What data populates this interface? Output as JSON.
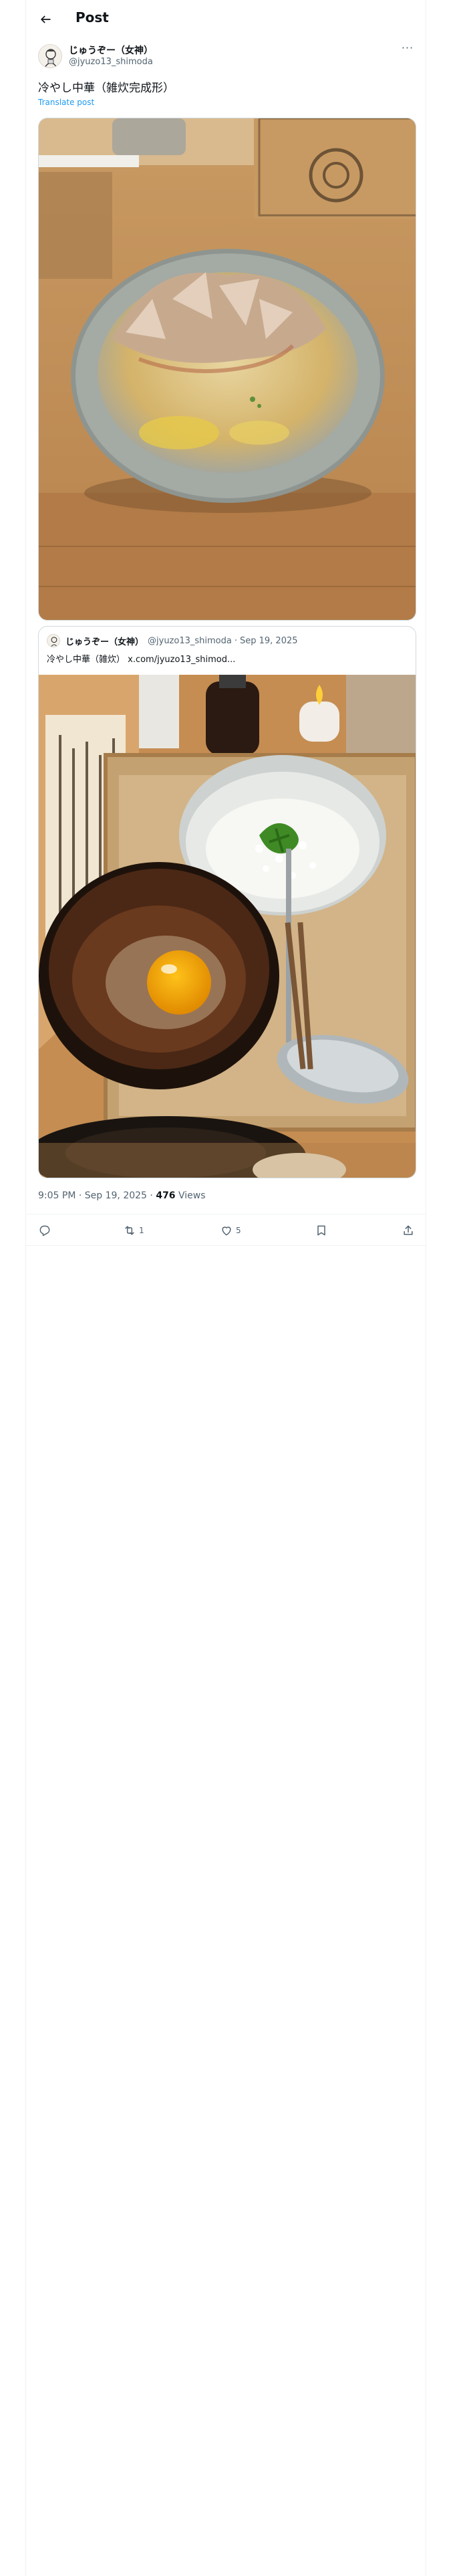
{
  "header": {
    "title": "Post",
    "back_icon": "arrow-left-icon"
  },
  "post": {
    "display_name": "じゅうぞー（女神）",
    "handle": "@jyuzo13_shimoda",
    "text": "冷やし中華（雑炊完成形）",
    "translate_label": "Translate post",
    "more_icon": "more-horizontal-icon",
    "time": "9:05 PM",
    "date": "Sep 19, 2025",
    "views_count": "476",
    "views_label": "Views",
    "sep": "·"
  },
  "quote": {
    "display_name": "じゅうぞー（女神）",
    "handle": "@jyuzo13_shimoda",
    "date": "Sep 19, 2025",
    "text": "冷やし中華（雑炊） x.com/jyuzo13_shimod..."
  },
  "actions": {
    "reply_count": "",
    "repost_count": "1",
    "like_count": "5",
    "bookmark_count": "",
    "icons": [
      "reply-icon",
      "repost-icon",
      "like-icon",
      "bookmark-icon",
      "share-icon"
    ]
  },
  "colors": {
    "accent": "#1d9bf0",
    "text": "#0f1419",
    "secondary": "#536471",
    "border": "#cfd9de"
  }
}
